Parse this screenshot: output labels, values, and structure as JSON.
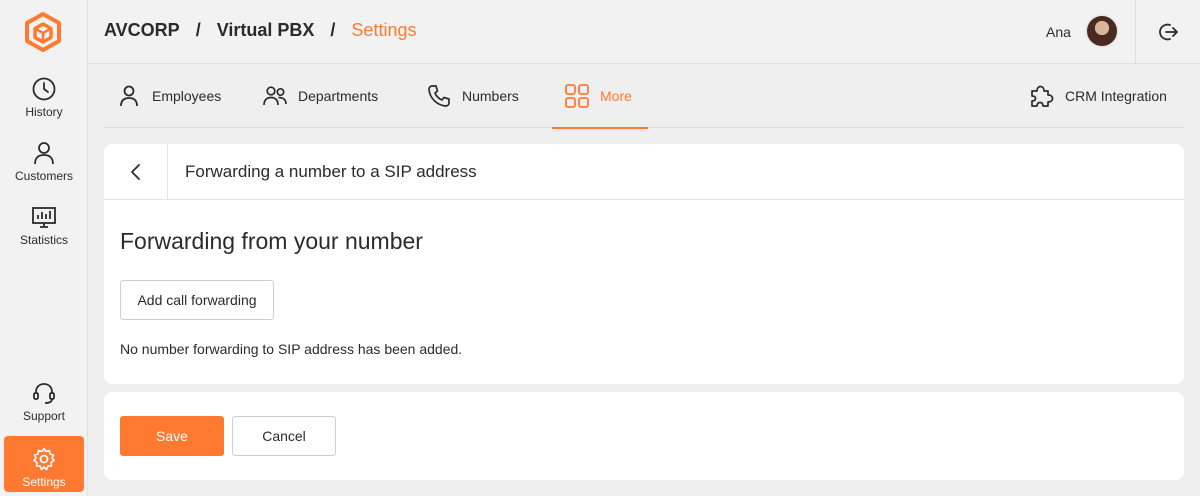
{
  "sidebar": {
    "items": [
      {
        "label": "History",
        "icon": "clock-icon"
      },
      {
        "label": "Customers",
        "icon": "person-icon"
      },
      {
        "label": "Statistics",
        "icon": "chart-monitor-icon"
      },
      {
        "label": "Support",
        "icon": "headset-icon"
      },
      {
        "label": "Settings",
        "icon": "gear-icon",
        "active": true
      }
    ]
  },
  "header": {
    "breadcrumb": [
      "AVCORP",
      "Virtual PBX",
      "Settings"
    ],
    "separator": "/",
    "user_name": "Ana"
  },
  "tabs": {
    "items": [
      {
        "label": "Employees",
        "icon": "person-icon"
      },
      {
        "label": "Departments",
        "icon": "group-icon"
      },
      {
        "label": "Numbers",
        "icon": "phone-icon"
      },
      {
        "label": "More",
        "icon": "grid-icon",
        "active": true
      }
    ],
    "crm": {
      "label": "CRM Integration",
      "icon": "puzzle-icon"
    }
  },
  "panel": {
    "title": "Forwarding a number to a SIP address",
    "section_title": "Forwarding from your number",
    "add_button": "Add call forwarding",
    "empty_text": "No number forwarding to SIP address has been added."
  },
  "actions": {
    "save": "Save",
    "cancel": "Cancel"
  },
  "colors": {
    "accent": "#ff7a30",
    "background": "#efefef",
    "panel": "#ffffff"
  }
}
